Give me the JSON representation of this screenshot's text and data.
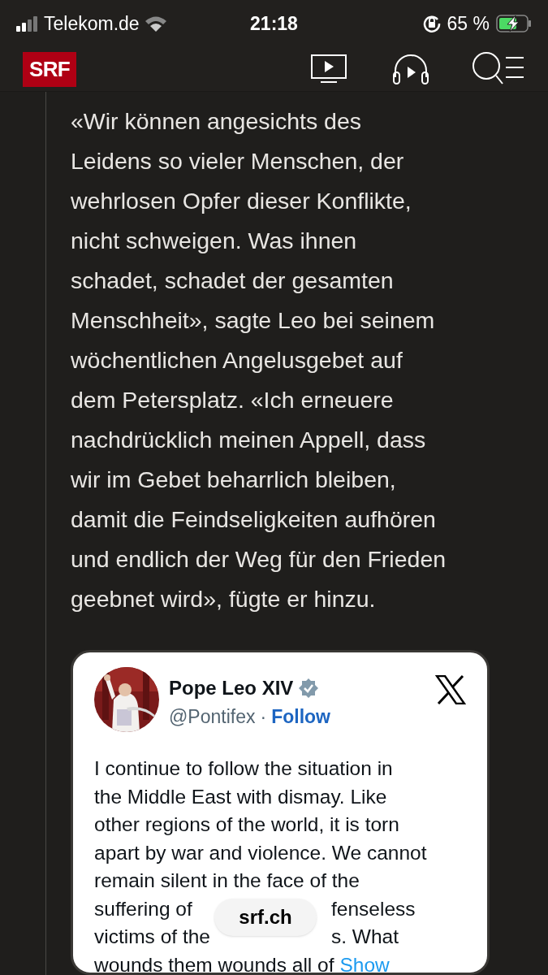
{
  "status_bar": {
    "carrier": "Telekom.de",
    "time": "21:18",
    "battery": "65 %",
    "charging": true
  },
  "nav": {
    "logo": "SRF"
  },
  "article": {
    "lines": [
      "«Wir können angesichts des",
      "Leidens so vieler Menschen, der",
      "wehrlosen Opfer dieser Konflikte,",
      "nicht schweigen. Was ihnen",
      "schadet, schadet der gesamten",
      "Menschheit», sagte Leo bei seinem",
      "wöchentlichen Angelusgebet auf",
      "dem Petersplatz. «Ich erneuere",
      "nachdrücklich meinen Appell, dass",
      "wir im Gebet beharrlich bleiben,",
      "damit die Feindseligkeiten aufhören",
      "und endlich der Weg für den Frieden",
      "geebnet wird», fügte er hinzu."
    ]
  },
  "tweet": {
    "name": "Pope Leo XIV",
    "verified": true,
    "handle": "@Pontifex",
    "separator": "·",
    "follow": "Follow",
    "lines": [
      [
        "I continue to follow the situation in"
      ],
      [
        "the Middle East with dismay. Like"
      ],
      [
        "other regions of the world, it is torn"
      ],
      [
        "apart by war and violence. We cannot"
      ],
      [
        "remain silent in the face of the"
      ],
      [
        "suffering of",
        "fenseless"
      ],
      [
        "victims of the",
        "s. What"
      ]
    ],
    "last_line": "wounds them wounds all of",
    "show_more": "Show"
  },
  "url_pill": "srf.ch"
}
